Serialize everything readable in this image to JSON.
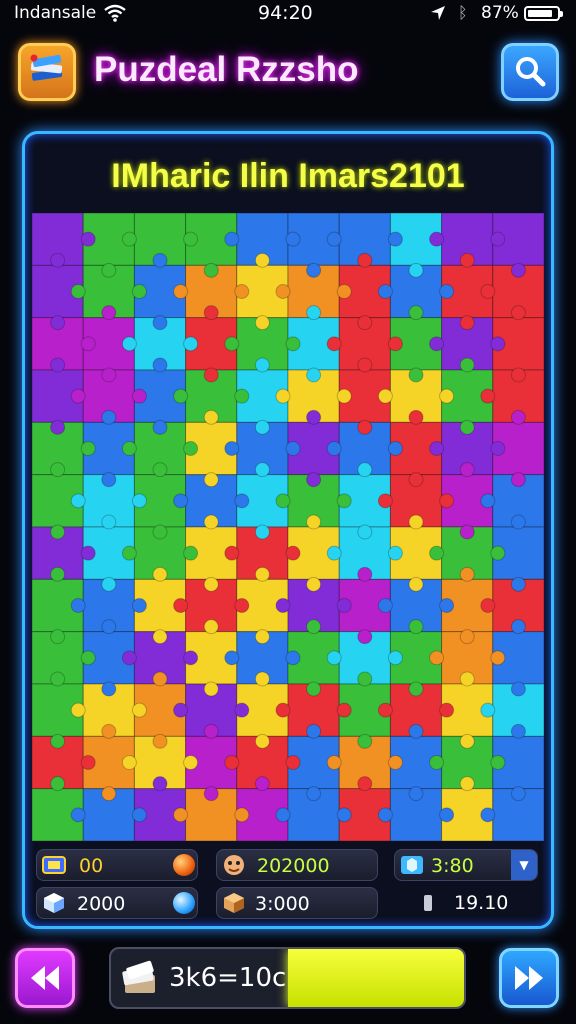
{
  "status_bar": {
    "carrier": "Indansale",
    "time": "94:20",
    "battery": "87%"
  },
  "header": {
    "title": "Puzdeal Rzzsho",
    "app_icon": "book-stack-icon",
    "search_icon": "magnifier-icon"
  },
  "board": {
    "title": "IMharic Ilin Imars2101",
    "colors": [
      "#7b1fd6",
      "#2dbb2e",
      "#1f6fe8",
      "#19d1f0",
      "#f6d21a",
      "#f18a16",
      "#e8232b",
      "#b313c7",
      "#0fa07e"
    ],
    "grid": [
      [
        0,
        1,
        1,
        1,
        2,
        2,
        2,
        3,
        0,
        0
      ],
      [
        0,
        1,
        2,
        5,
        4,
        5,
        6,
        2,
        6,
        6
      ],
      [
        7,
        7,
        3,
        6,
        1,
        3,
        6,
        1,
        0,
        6
      ],
      [
        0,
        7,
        2,
        1,
        3,
        4,
        6,
        4,
        1,
        6
      ],
      [
        1,
        2,
        1,
        4,
        2,
        0,
        2,
        6,
        0,
        7
      ],
      [
        1,
        3,
        1,
        2,
        3,
        1,
        3,
        6,
        7,
        2
      ],
      [
        0,
        3,
        1,
        4,
        6,
        4,
        3,
        4,
        1,
        2
      ],
      [
        1,
        2,
        4,
        6,
        4,
        0,
        7,
        2,
        5,
        6
      ],
      [
        1,
        2,
        0,
        4,
        2,
        1,
        3,
        1,
        5,
        2
      ],
      [
        1,
        4,
        5,
        0,
        4,
        6,
        1,
        6,
        4,
        3
      ],
      [
        6,
        5,
        4,
        7,
        6,
        2,
        5,
        2,
        1,
        2
      ],
      [
        1,
        2,
        0,
        5,
        7,
        2,
        6,
        2,
        4,
        2
      ]
    ]
  },
  "stats": {
    "moves": {
      "value": "00",
      "icon": "tile-icon"
    },
    "score": {
      "value": "202000",
      "icon": "character-icon"
    },
    "stars": {
      "value": "3:80",
      "icon": "gem-icon"
    },
    "pieces": {
      "value": "2000",
      "icon": "cube-icon"
    },
    "coins": {
      "value": "3:000",
      "icon": "crate-icon"
    },
    "time": {
      "value": "19.10",
      "icon": "timer-icon"
    }
  },
  "progress": {
    "label": "3k6=10c",
    "fraction": 0.5
  }
}
